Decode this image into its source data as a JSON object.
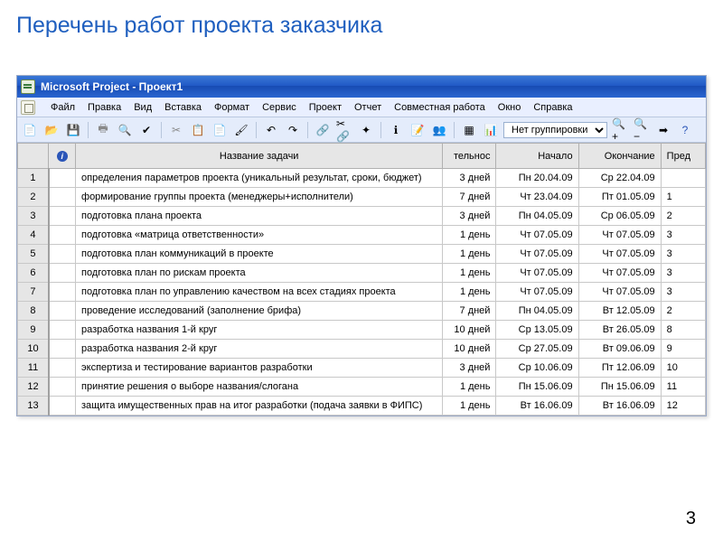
{
  "slide": {
    "title": "Перечень работ проекта заказчика",
    "page_number": "3"
  },
  "titlebar": {
    "text": "Microsoft Project - Проект1"
  },
  "menubar": {
    "items": [
      "Файл",
      "Правка",
      "Вид",
      "Вставка",
      "Формат",
      "Сервис",
      "Проект",
      "Отчет",
      "Совместная работа",
      "Окно",
      "Справка"
    ]
  },
  "toolbar": {
    "grouping_label": "Нет группировки"
  },
  "table": {
    "headers": {
      "info": "i",
      "name": "Название задачи",
      "duration": "тельнос",
      "start": "Начало",
      "end": "Окончание",
      "pred": "Пред"
    },
    "rows": [
      {
        "n": "1",
        "name": "определения параметров проекта (уникальный результат, сроки, бюджет)",
        "dur": "3 дней",
        "start": "Пн 20.04.09",
        "end": "Ср 22.04.09",
        "pred": ""
      },
      {
        "n": "2",
        "name": "формирование группы проекта (менеджеры+исполнители)",
        "dur": "7 дней",
        "start": "Чт 23.04.09",
        "end": "Пт 01.05.09",
        "pred": "1"
      },
      {
        "n": "3",
        "name": "подготовка плана проекта",
        "dur": "3 дней",
        "start": "Пн 04.05.09",
        "end": "Ср 06.05.09",
        "pred": "2"
      },
      {
        "n": "4",
        "name": "подготовка «матрица ответственности»",
        "dur": "1 день",
        "start": "Чт 07.05.09",
        "end": "Чт 07.05.09",
        "pred": "3"
      },
      {
        "n": "5",
        "name": "подготовка  план коммуникаций в проекте",
        "dur": "1 день",
        "start": "Чт 07.05.09",
        "end": "Чт 07.05.09",
        "pred": "3"
      },
      {
        "n": "6",
        "name": "подготовка план по рискам проекта",
        "dur": "1 день",
        "start": "Чт 07.05.09",
        "end": "Чт 07.05.09",
        "pred": "3"
      },
      {
        "n": "7",
        "name": "подготовка план по управлению качеством на всех стадиях проекта",
        "dur": "1 день",
        "start": "Чт 07.05.09",
        "end": "Чт 07.05.09",
        "pred": "3"
      },
      {
        "n": "8",
        "name": "проведение исследований (заполнение брифа)",
        "dur": "7 дней",
        "start": "Пн 04.05.09",
        "end": "Вт 12.05.09",
        "pred": "2"
      },
      {
        "n": "9",
        "name": "разработка названия 1-й круг",
        "dur": "10 дней",
        "start": "Ср 13.05.09",
        "end": "Вт 26.05.09",
        "pred": "8"
      },
      {
        "n": "10",
        "name": "разработка названия  2-й круг",
        "dur": "10 дней",
        "start": "Ср 27.05.09",
        "end": "Вт 09.06.09",
        "pred": "9"
      },
      {
        "n": "11",
        "name": "экспертиза и тестирование вариантов разработки",
        "dur": "3 дней",
        "start": "Ср 10.06.09",
        "end": "Пт 12.06.09",
        "pred": "10"
      },
      {
        "n": "12",
        "name": "принятие решения о выборе названия/слогана",
        "dur": "1 день",
        "start": "Пн 15.06.09",
        "end": "Пн 15.06.09",
        "pred": "11"
      },
      {
        "n": "13",
        "name": "защита имущественных прав на итог разработки (подача заявки в ФИПС)",
        "dur": "1 день",
        "start": "Вт 16.06.09",
        "end": "Вт 16.06.09",
        "pred": "12"
      }
    ]
  }
}
